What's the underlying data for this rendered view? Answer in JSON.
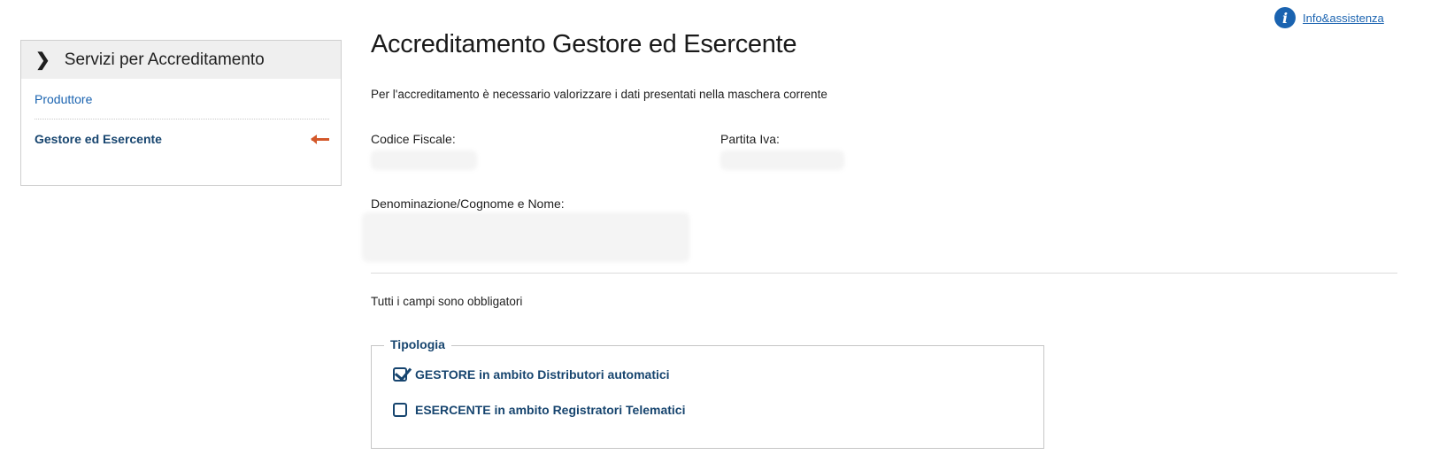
{
  "header": {
    "info_icon": "info-icon",
    "info_link_label": "Info&assistenza"
  },
  "sidebar": {
    "title": "Servizi per Accreditamento",
    "items": [
      {
        "label": "Produttore",
        "active": false
      },
      {
        "label": "Gestore ed Esercente",
        "active": true
      }
    ]
  },
  "main": {
    "title": "Accreditamento Gestore ed Esercente",
    "intro": "Per l'accreditamento è necessario valorizzare i dati presentati nella maschera corrente",
    "fields": {
      "codice_fiscale_label": "Codice Fiscale:",
      "partita_iva_label": "Partita Iva:",
      "denominazione_label": "Denominazione/Cognome e Nome:"
    },
    "required_note": "Tutti i campi sono obbligatori",
    "tipologia": {
      "legend": "Tipologia",
      "options": [
        {
          "label": "GESTORE in ambito Distributori automatici",
          "checked": true
        },
        {
          "label": "ESERCENTE in ambito Registratori Telematici",
          "checked": false
        }
      ]
    }
  },
  "colors": {
    "accent": "#1a63b0",
    "dark_accent": "#17456f",
    "arrow": "#d3582a"
  }
}
